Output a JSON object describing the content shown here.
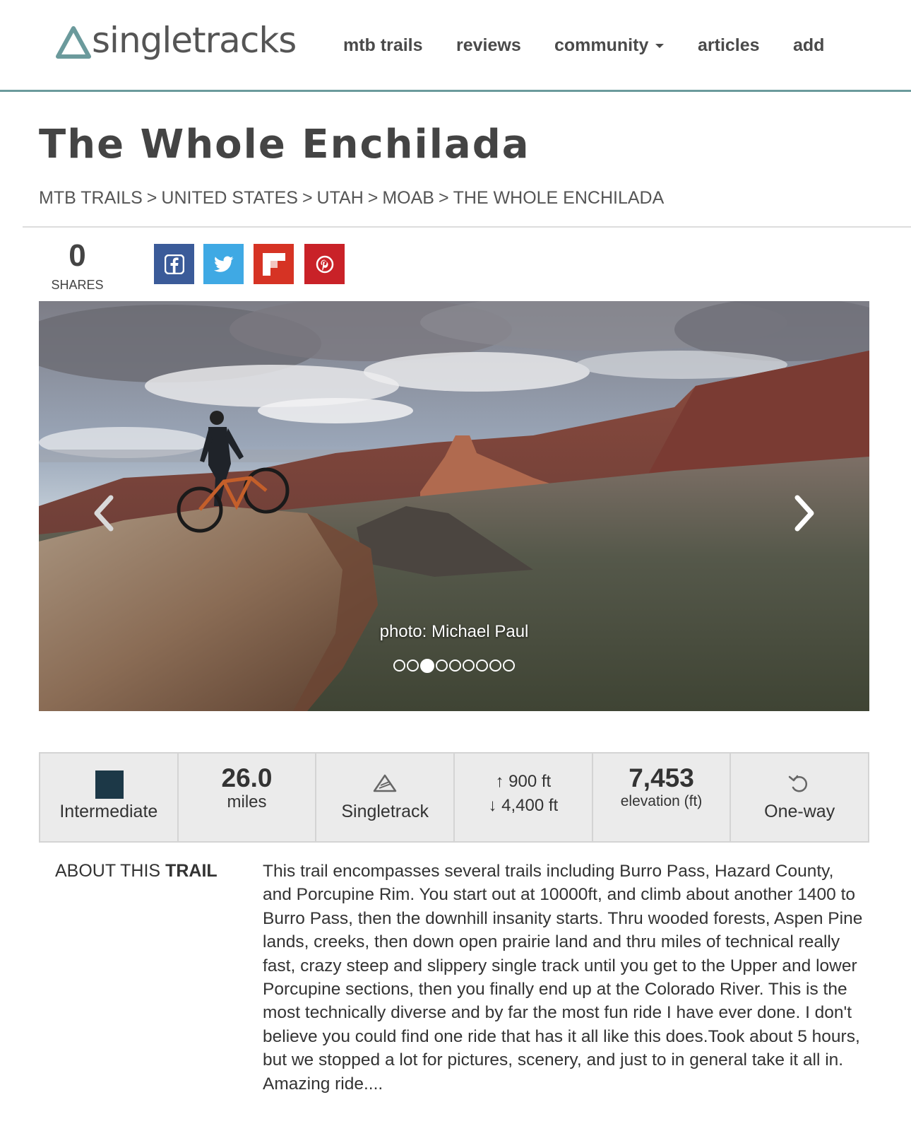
{
  "brand": {
    "logo_text": "singletracks"
  },
  "nav": {
    "items": [
      {
        "label": "mtb trails"
      },
      {
        "label": "reviews"
      },
      {
        "label": "community"
      },
      {
        "label": "articles"
      },
      {
        "label": "add"
      }
    ]
  },
  "page": {
    "title": "The Whole Enchilada"
  },
  "breadcrumb": [
    "MTB TRAILS",
    "UNITED STATES",
    "UTAH",
    "MOAB",
    "THE WHOLE ENCHILADA"
  ],
  "breadcrumb_separator": ">",
  "shares": {
    "count": "0",
    "label": "SHARES"
  },
  "social": {
    "facebook_icon": "facebook-icon",
    "twitter_icon": "twitter-icon",
    "flipboard_icon": "flipboard-icon",
    "pinterest_icon": "pinterest-icon"
  },
  "slideshow": {
    "caption": "photo: Michael Paul",
    "dot_count": 9,
    "active_index": 2
  },
  "stats": {
    "difficulty": {
      "label": "Intermediate",
      "color": "#1c3847"
    },
    "distance": {
      "value": "26.0",
      "unit": "miles"
    },
    "trail_type": {
      "label": "Singletrack",
      "icon": "singletrack-icon"
    },
    "elevation_change": {
      "up": "↑ 900 ft",
      "down": "↓ 4,400 ft"
    },
    "elevation": {
      "value": "7,453",
      "unit": "elevation (ft)"
    },
    "direction": {
      "label": "One-way",
      "icon": "undo-arrow-icon"
    }
  },
  "about": {
    "heading_prefix": "ABOUT THIS ",
    "heading_bold": "TRAIL",
    "description": "This trail encompasses several trails including Burro Pass, Hazard County, and Porcupine Rim. You start out at 10000ft, and climb about another 1400 to Burro Pass, then the downhill insanity starts. Thru wooded forests, Aspen Pine lands, creeks, then down open prairie land and thru miles of technical really fast, crazy steep and slippery single track until you get to the Upper and lower Porcupine sections, then you finally end up at the Colorado River. This is the most technically diverse and by far the most fun ride I have ever done. I don't believe you could find one ride that has it all like this does.Took about 5 hours, but we stopped a lot for pictures, scenery, and just to in general take it all in. Amazing ride...."
  },
  "colors": {
    "accent": "#6b9a9c",
    "facebook": "#3b5b99",
    "twitter": "#3fa9e4",
    "flipboard": "#d63324",
    "pinterest": "#c92228"
  }
}
